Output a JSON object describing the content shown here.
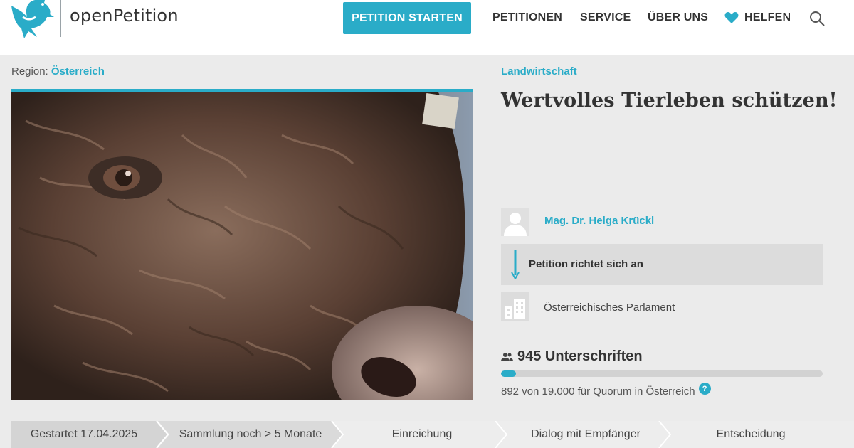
{
  "header": {
    "logo_text": "openPetition",
    "cta_label": "PETITION STARTEN",
    "nav": [
      "PETITIONEN",
      "SERVICE",
      "ÜBER UNS"
    ],
    "help_label": "HELFEN",
    "colors": {
      "accent": "#2aacc8",
      "header_bg": "#ffffff"
    },
    "icons": [
      "dove-logo-icon",
      "heart-icon",
      "search-icon"
    ]
  },
  "petition": {
    "region_label": "Region:",
    "region_value": "Österreich",
    "category": "Landwirtschaft",
    "title": "Wertvolles Tierleben schützen!",
    "author": "Mag. Dr. Helga Krückl",
    "recipient_label": "Petition richtet sich an",
    "recipient_name": "Österreichisches Parlament",
    "signatures": "945 Unterschriften",
    "quorum_text": "892 von 19.000 für Quorum in Österreich",
    "quorum_progress": 0.047,
    "help_badge": "?"
  },
  "steps": [
    {
      "label": "Gestartet 17.04.2025",
      "state": "done"
    },
    {
      "label": "Sammlung noch > 5 Monate",
      "state": "active"
    },
    {
      "label": "Einreichung",
      "state": "pending"
    },
    {
      "label": "Dialog mit Empfänger",
      "state": "pending"
    },
    {
      "label": "Entscheidung",
      "state": "pending"
    }
  ]
}
